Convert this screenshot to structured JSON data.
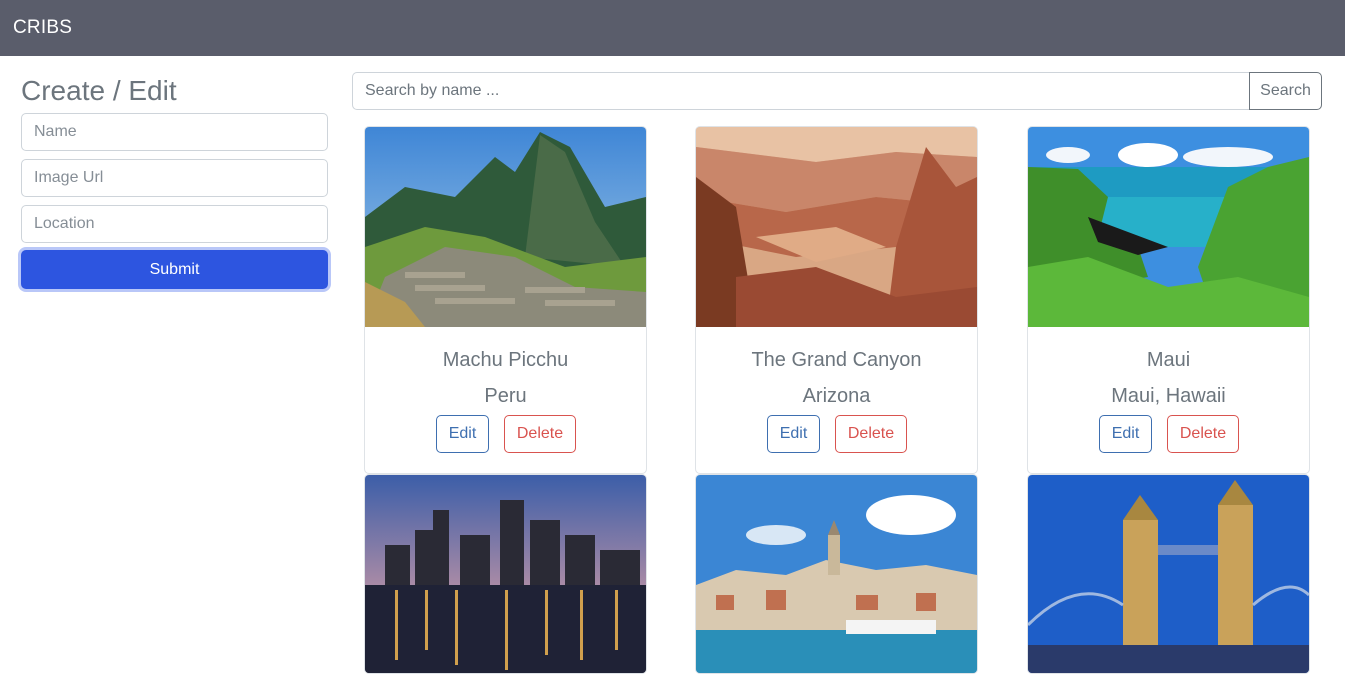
{
  "navbar": {
    "brand": "CRIBS"
  },
  "form": {
    "title": "Create / Edit",
    "name_placeholder": "Name",
    "image_placeholder": "Image Url",
    "location_placeholder": "Location",
    "submit_label": "Submit"
  },
  "search": {
    "placeholder": "Search by name ...",
    "button_label": "Search"
  },
  "cards": [
    {
      "name": "Machu Picchu",
      "location": "Peru",
      "edit_label": "Edit",
      "delete_label": "Delete"
    },
    {
      "name": "The Grand Canyon",
      "location": "Arizona",
      "edit_label": "Edit",
      "delete_label": "Delete"
    },
    {
      "name": "Maui",
      "location": "Maui, Hawaii",
      "edit_label": "Edit",
      "delete_label": "Delete"
    },
    {
      "name": "",
      "location": ""
    },
    {
      "name": "",
      "location": ""
    },
    {
      "name": "",
      "location": ""
    }
  ],
  "colors": {
    "navbar_bg": "#5a5d6b",
    "primary": "#2d55e0",
    "edit_outline": "#3e6fb0",
    "delete_outline": "#d9534f"
  }
}
